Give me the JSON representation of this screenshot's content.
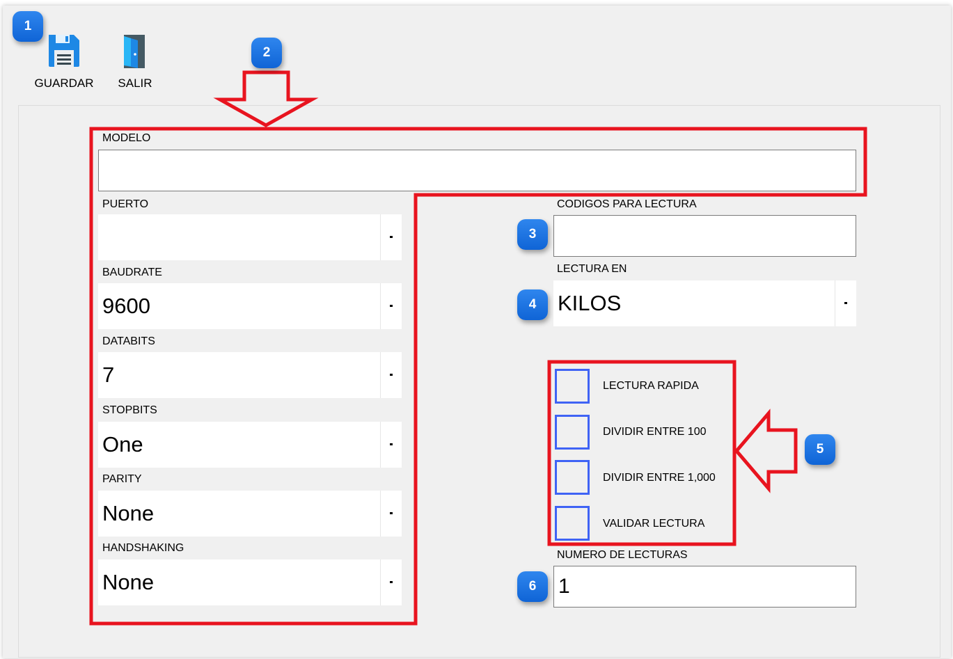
{
  "toolbar": {
    "save_label": "GUARDAR",
    "exit_label": "SALIR"
  },
  "form": {
    "modelo": {
      "label": "MODELO",
      "value": ""
    },
    "puerto": {
      "label": "PUERTO",
      "value": ""
    },
    "baudrate": {
      "label": "BAUDRATE",
      "value": "9600"
    },
    "databits": {
      "label": "DATABITS",
      "value": "7"
    },
    "stopbits": {
      "label": "STOPBITS",
      "value": "One"
    },
    "parity": {
      "label": "PARITY",
      "value": "None"
    },
    "handshaking": {
      "label": "HANDSHAKING",
      "value": "None"
    },
    "codigos": {
      "label": "CODIGOS PARA LECTURA",
      "value": ""
    },
    "lectura_en": {
      "label": "LECTURA EN",
      "value": "KILOS"
    },
    "options": [
      {
        "label": "LECTURA RAPIDA",
        "checked": false
      },
      {
        "label": "DIVIDIR ENTRE 100",
        "checked": false
      },
      {
        "label": "DIVIDIR ENTRE 1,000",
        "checked": false
      },
      {
        "label": "VALIDAR LECTURA",
        "checked": false
      }
    ],
    "numero_lecturas": {
      "label": "NUMERO DE LECTURAS",
      "value": "1"
    }
  },
  "annotations": {
    "badges": [
      "1",
      "2",
      "3",
      "4",
      "5",
      "6"
    ],
    "highlight_color": "#e8141f",
    "badge_color": "#1a73e8"
  },
  "icons": {
    "save": "floppy-disk-icon",
    "exit": "door-exit-icon",
    "dropdown": "chevron-down-icon"
  }
}
